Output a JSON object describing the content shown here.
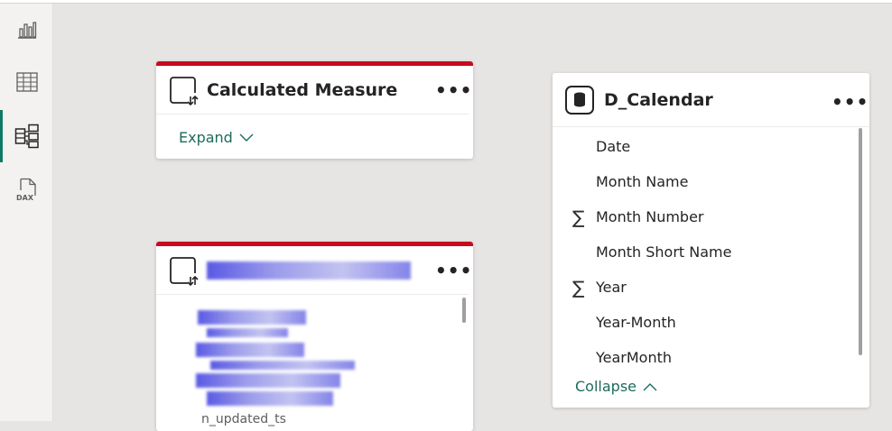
{
  "sidebar": {
    "items": [
      {
        "name": "report-view",
        "icon": "bar-chart-icon"
      },
      {
        "name": "table-view",
        "icon": "table-icon"
      },
      {
        "name": "model-view",
        "icon": "model-icon",
        "active": true
      },
      {
        "name": "dax-query-view",
        "icon": "dax-icon",
        "icon_text": "DAX"
      }
    ]
  },
  "cards": {
    "calculated_measure": {
      "title": "Calculated Measure",
      "more": "•••",
      "expand_label": "Expand"
    },
    "redacted_table": {
      "more": "•••",
      "partial_field": "n_updated_ts"
    },
    "d_calendar": {
      "title": "D_Calendar",
      "more": "•••",
      "fields": [
        {
          "label": "Date",
          "sigma": false
        },
        {
          "label": "Month Name",
          "sigma": false
        },
        {
          "label": "Month Number",
          "sigma": true
        },
        {
          "label": "Month Short Name",
          "sigma": false
        },
        {
          "label": "Year",
          "sigma": true
        },
        {
          "label": "Year-Month",
          "sigma": false
        },
        {
          "label": "YearMonth",
          "sigma": false
        }
      ],
      "sigma_symbol": "∑",
      "collapse_label": "Collapse"
    }
  },
  "colors": {
    "accent": "#117865",
    "header_bar": "#c80a1d",
    "link": "#1d6b5d"
  }
}
